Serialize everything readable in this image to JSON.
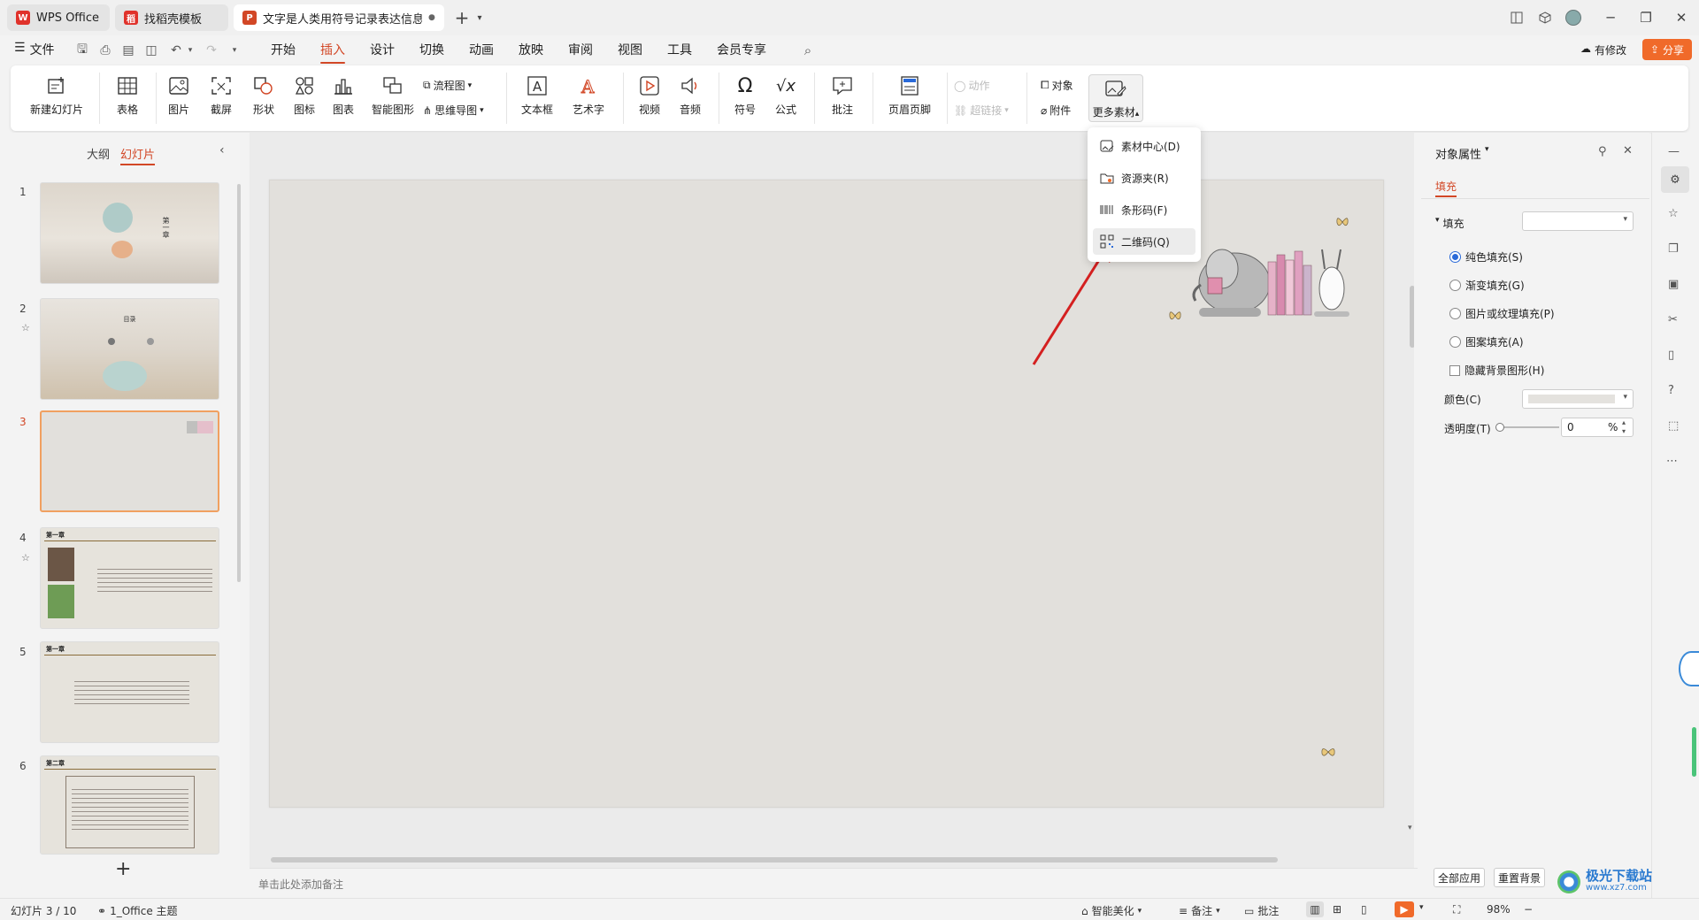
{
  "tabs": [
    {
      "label": "WPS Office",
      "logo": "W"
    },
    {
      "label": "找稻壳模板",
      "logo": "稻"
    },
    {
      "label": "文字是人类用符号记录表达信息以",
      "logo": "P"
    }
  ],
  "menu": {
    "file": "文件",
    "items": [
      "开始",
      "插入",
      "设计",
      "切换",
      "动画",
      "放映",
      "审阅",
      "视图",
      "工具",
      "会员专享"
    ],
    "active": "插入",
    "pending": "有修改",
    "share": "分享"
  },
  "ribbon": {
    "new_slide": "新建幻灯片",
    "table": "表格",
    "picture": "图片",
    "screenshot": "截屏",
    "shape": "形状",
    "icon": "图标",
    "chart": "图表",
    "smart_shape": "智能图形",
    "flowchart": "流程图",
    "mindmap": "思维导图",
    "textbox": "文本框",
    "wordart": "艺术字",
    "video": "视频",
    "audio": "音频",
    "symbol": "符号",
    "formula": "公式",
    "comment": "批注",
    "header_footer": "页眉页脚",
    "action": "动作",
    "hyperlink": "超链接",
    "object": "对象",
    "attachment": "附件",
    "more_material": "更多素材"
  },
  "dropdown": [
    {
      "label": "素材中心(D)",
      "icon": "material-center-icon"
    },
    {
      "label": "资源夹(R)",
      "icon": "resource-folder-icon"
    },
    {
      "label": "条形码(F)",
      "icon": "barcode-icon"
    },
    {
      "label": "二维码(Q)",
      "icon": "qrcode-icon"
    }
  ],
  "left_panel": {
    "tab_outline": "大纲",
    "tab_slides": "幻灯片",
    "slides": [
      {
        "num": "1",
        "heading": "第一章"
      },
      {
        "num": "2",
        "heading": "目录"
      },
      {
        "num": "3",
        "heading": ""
      },
      {
        "num": "4",
        "heading": "第一章"
      },
      {
        "num": "5",
        "heading": "第一章"
      },
      {
        "num": "6",
        "heading": "第二章"
      }
    ],
    "add": "+"
  },
  "right_panel": {
    "title": "对象属性",
    "tab_fill": "填充",
    "section_fill": "填充",
    "options": [
      "纯色填充(S)",
      "渐变填充(G)",
      "图片或纹理填充(P)",
      "图案填充(A)"
    ],
    "hide_bg": "隐藏背景图形(H)",
    "color_label": "颜色(C)",
    "transparency_label": "透明度(T)",
    "transparency_value": "0",
    "percent": "%",
    "apply_all": "全部应用",
    "reset_bg": "重置背景"
  },
  "notes_placeholder": "单击此处添加备注",
  "status": {
    "slide_info": "幻灯片 3 / 10",
    "theme": "1_Office 主题",
    "beautify": "智能美化",
    "notes": "备注",
    "comments": "批注",
    "zoom": "98%"
  },
  "watermark": "极光下载站",
  "watermark_url": "www.xz7.com",
  "colors": {
    "accent": "#d24726",
    "share_bg": "#f06a2a",
    "selected_thumb": "#f0a060",
    "arrow": "#d42020"
  }
}
